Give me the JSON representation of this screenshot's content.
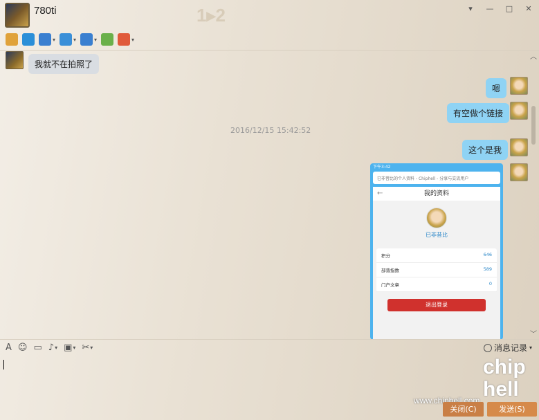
{
  "window": {
    "title": "780ti",
    "watermark_badge": "1▸2",
    "buttons": [
      "▾",
      "—",
      "□",
      "✕"
    ]
  },
  "toolbar": {
    "items": [
      {
        "icon": "microphone-icon",
        "color": "#e0a23a",
        "caret": false
      },
      {
        "icon": "camera-icon",
        "color": "#2b8fd8",
        "caret": false
      },
      {
        "icon": "screen-share-icon",
        "color": "#3a7fd0",
        "caret": true
      },
      {
        "icon": "folder-transfer-icon",
        "color": "#3a8fd8",
        "caret": true
      },
      {
        "icon": "remote-desktop-icon",
        "color": "#3a7fd0",
        "caret": true
      },
      {
        "icon": "add-message-icon",
        "color": "#6ab04a",
        "caret": false
      },
      {
        "icon": "apps-grid-icon",
        "color": "#e05a3a",
        "caret": true
      }
    ]
  },
  "chat": {
    "messages": [
      {
        "side": "left",
        "text": "我就不在拍照了"
      },
      {
        "side": "right",
        "text": "嗯"
      },
      {
        "side": "right",
        "text": "有空做个链接"
      },
      {
        "side": "right",
        "text": "这个是我"
      }
    ],
    "timestamp": "2016/12/15 15:42:52",
    "screenshot": {
      "status": "下午3:42",
      "url": "已非昔比的个人资料 - Chiphell - 分享与交流用户",
      "header": "我的资料",
      "back": "←",
      "username": "已非昔比",
      "rows": [
        {
          "label": "积分",
          "value": "646"
        },
        {
          "label": "部落指数",
          "value": "589"
        },
        {
          "label": "门户文章",
          "value": "0"
        }
      ],
      "logout": "退出登录"
    }
  },
  "input_toolbar": {
    "history_label": "消息记录",
    "caret": "▾",
    "items": [
      {
        "icon": "font-icon",
        "glyph": "A",
        "caret": false
      },
      {
        "icon": "emoji-icon",
        "glyph": "☺",
        "caret": false
      },
      {
        "icon": "gif-icon",
        "glyph": "▭",
        "caret": false
      },
      {
        "icon": "voice-icon",
        "glyph": "♪",
        "caret": true
      },
      {
        "icon": "image-icon",
        "glyph": "▣",
        "caret": true
      },
      {
        "icon": "scissors-icon",
        "glyph": "✂",
        "caret": true
      }
    ]
  },
  "watermark": {
    "site": "www.chiphell.com",
    "logo": "chip hell"
  },
  "buttons": {
    "close": "关闭(C)",
    "send": "发送(S)"
  },
  "scroll": {
    "up": "︿",
    "down": "﹀"
  }
}
